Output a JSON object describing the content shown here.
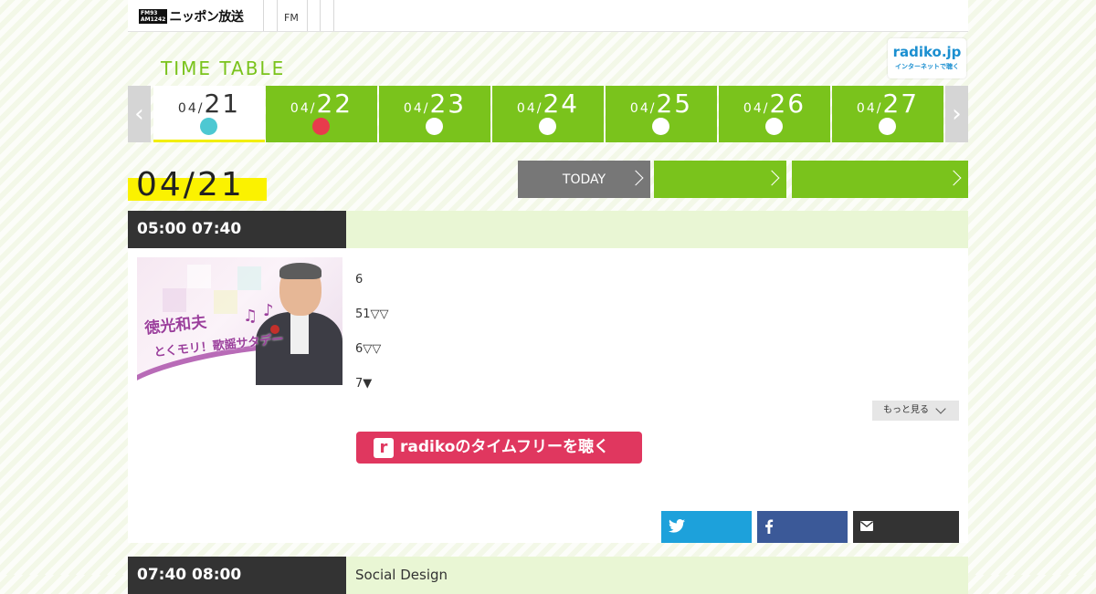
{
  "header": {
    "brand_mark_line1": "FM93",
    "brand_mark_line2": "AM1242",
    "brand_name": "ニッポン放送",
    "fm_label": "FM"
  },
  "timetable": {
    "title": "TIME TABLE"
  },
  "radiko_badge": {
    "line1": "radiko.jp",
    "line2": "インターネットで聴く"
  },
  "date_nav": {
    "days": [
      {
        "month": "04/",
        "day": "21",
        "active": true
      },
      {
        "month": "04/",
        "day": "22",
        "dot": "red"
      },
      {
        "month": "04/",
        "day": "23"
      },
      {
        "month": "04/",
        "day": "24"
      },
      {
        "month": "04/",
        "day": "25"
      },
      {
        "month": "04/",
        "day": "26"
      },
      {
        "month": "04/",
        "day": "27"
      }
    ]
  },
  "current_date": "04/21",
  "nav_buttons": {
    "today": "TODAY",
    "prev": "",
    "next": ""
  },
  "programs": [
    {
      "time": "05:00  07:40",
      "title": "",
      "thumb_caption": "徳光和夫",
      "thumb_caption2": "とくモリ！歌謡サタデー",
      "description": [
        "6",
        "51▽▽",
        "6▽▽",
        "7▼"
      ],
      "more_label": "もっと見る",
      "radiko_label": "radikoのタイムフリーを聴く"
    },
    {
      "time": "07:40  08:00",
      "title": "Social Design"
    }
  ],
  "share": {
    "twitter_icon": "twitter-icon",
    "facebook_icon": "facebook-icon",
    "mail_icon": "mail-icon"
  },
  "colors": {
    "green": "#7ac31c",
    "yellow": "#fbf200",
    "radiko_red": "#e0375f",
    "dark": "#333333"
  }
}
